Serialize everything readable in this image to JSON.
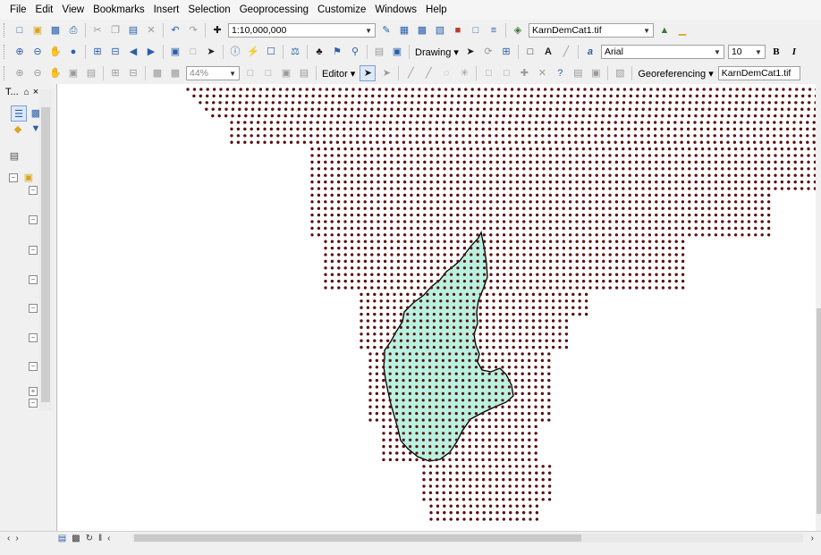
{
  "menu": [
    "File",
    "Edit",
    "View",
    "Bookmarks",
    "Insert",
    "Selection",
    "Geoprocessing",
    "Customize",
    "Windows",
    "Help"
  ],
  "toolbar": {
    "scale": "1:10,000,000",
    "layer": "KarnDemCat1.tif",
    "font": "Arial",
    "font_size": "10",
    "bold": "B",
    "italic": "I",
    "drawing": "Drawing",
    "editor": "Editor",
    "georef": "Georeferencing",
    "georef_layer": "KarnDemCat1.tif",
    "zoom": "44%"
  },
  "toc": {
    "title": "T...",
    "pin": "⌂",
    "close": "×"
  },
  "map": {
    "point_color": "#5a0f12",
    "polygon_fill": "#b8f2e0",
    "polygon_stroke": "#000000"
  }
}
